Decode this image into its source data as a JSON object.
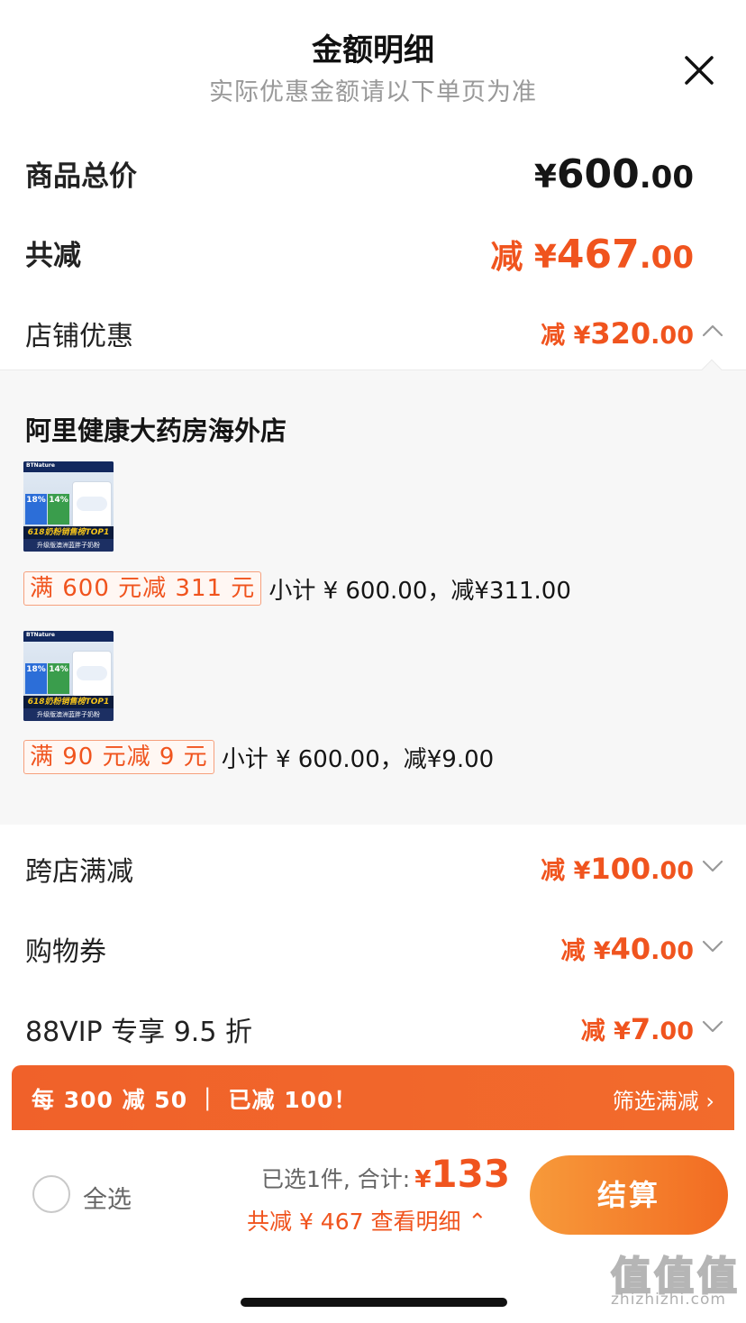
{
  "header": {
    "title": "金额明细",
    "subtitle": "实际优惠金额请以下单页为准"
  },
  "summary": {
    "total_label": "商品总价",
    "total_yen": "¥",
    "total_int": "600",
    "total_dec": ".00",
    "reduce_label": "共减",
    "reduce_prefix": "减 ¥",
    "reduce_int": "467",
    "reduce_dec": ".00"
  },
  "discounts": {
    "store": {
      "label": "店铺优惠",
      "prefix": "减 ¥",
      "int": "320",
      "dec": ".00",
      "expanded": true
    },
    "cross_store": {
      "label": "跨店满减",
      "prefix": "减 ¥",
      "int": "100",
      "dec": ".00"
    },
    "coupon": {
      "label": "购物券",
      "prefix": "减 ¥",
      "int": "40",
      "dec": ".00"
    },
    "vip": {
      "label": "88VIP 专享 9.5 折",
      "prefix": "减 ¥",
      "int": "7",
      "dec": ".00"
    }
  },
  "store_detail": {
    "store_name": "阿里健康大药房海外店",
    "items": [
      {
        "thumb_brand": "BTNature",
        "thumb_badge1": "18%",
        "thumb_badge2": "14%",
        "thumb_banner": "618奶粉销售榜TOP1",
        "thumb_footer": "升级版澳洲蓝胖子奶粉",
        "promo_tag": "满 600 元减 311 元",
        "promo_text": "小计 ¥ 600.00，减¥311.00"
      },
      {
        "thumb_brand": "BTNature",
        "thumb_badge1": "18%",
        "thumb_badge2": "14%",
        "thumb_banner": "618奶粉销售榜TOP1",
        "thumb_footer": "升级版澳洲蓝胖子奶粉",
        "promo_tag": "满 90 元减 9 元",
        "promo_text": "小计 ¥ 600.00，减¥9.00"
      }
    ]
  },
  "banner": {
    "left": "每 300 减 50 ｜ 已减 100！",
    "right": "筛选满减 ›"
  },
  "bottom_bar": {
    "select_all": "全选",
    "selected_text": "已选1件, 合计:",
    "total_yen": "¥",
    "total_amount": "133",
    "reduce_detail": "共减 ¥ 467  查看明细 ⌃",
    "checkout": "结算"
  },
  "watermark": {
    "glyphs": [
      "值",
      "值",
      "值"
    ],
    "url": "zhizhizhi.com"
  },
  "colors": {
    "accent": "#f0541e",
    "banner": "#f0612a",
    "checkout_start": "#f79a3a",
    "checkout_end": "#f26b22"
  }
}
